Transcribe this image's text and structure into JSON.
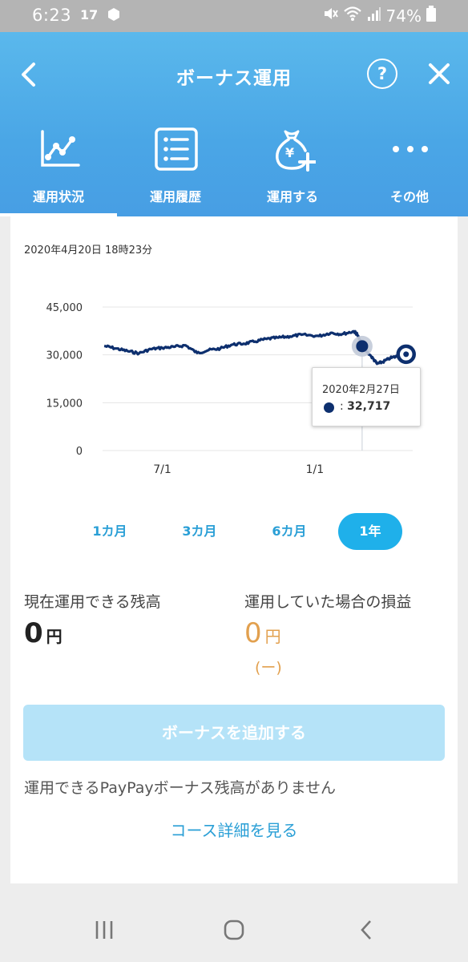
{
  "status_bar": {
    "time": "6:23",
    "notification": "17",
    "battery": "74%"
  },
  "header": {
    "title": "ボーナス運用",
    "help": "?"
  },
  "tabs": [
    {
      "label": "運用状況",
      "icon": "line-chart-icon",
      "active": true
    },
    {
      "label": "運用履歴",
      "icon": "list-icon",
      "active": false
    },
    {
      "label": "運用する",
      "icon": "money-bag-plus-icon",
      "active": false
    },
    {
      "label": "その他",
      "icon": "more-dots-icon",
      "active": false
    }
  ],
  "chart_section": {
    "timestamp": "2020年4月20日 18時23分",
    "tooltip": {
      "date": "2020年2月27日",
      "prefix": ":",
      "value": "32,717"
    }
  },
  "chart_data": {
    "type": "line",
    "yticks": [
      "45,000",
      "30,000",
      "15,000",
      "0"
    ],
    "ylim": [
      0,
      45000
    ],
    "xticks": [
      "7/1",
      "1/1"
    ],
    "grid": true,
    "series": [
      {
        "color": "#0d2f6e",
        "points": [
          [
            "2019-04-22",
            32800
          ],
          [
            "2019-05-06",
            32000
          ],
          [
            "2019-05-20",
            31200
          ],
          [
            "2019-06-03",
            30500
          ],
          [
            "2019-06-17",
            31800
          ],
          [
            "2019-07-01",
            32200
          ],
          [
            "2019-07-15",
            32500
          ],
          [
            "2019-07-29",
            33000
          ],
          [
            "2019-08-12",
            30600
          ],
          [
            "2019-08-26",
            31500
          ],
          [
            "2019-09-09",
            32000
          ],
          [
            "2019-09-23",
            33200
          ],
          [
            "2019-10-07",
            33500
          ],
          [
            "2019-10-21",
            34200
          ],
          [
            "2019-11-04",
            35000
          ],
          [
            "2019-11-18",
            35400
          ],
          [
            "2019-12-02",
            35800
          ],
          [
            "2019-12-16",
            36300
          ],
          [
            "2020-01-06",
            35900
          ],
          [
            "2020-01-20",
            36900
          ],
          [
            "2020-02-03",
            36500
          ],
          [
            "2020-02-17",
            37400
          ],
          [
            "2020-02-21",
            36500
          ],
          [
            "2020-02-27",
            32717
          ],
          [
            "2020-03-09",
            29500
          ],
          [
            "2020-03-16",
            27200
          ],
          [
            "2020-03-23",
            27800
          ],
          [
            "2020-04-01",
            29000
          ],
          [
            "2020-04-10",
            29600
          ],
          [
            "2020-04-20",
            30200
          ]
        ],
        "highlight_date": "2020-02-27",
        "highlight_value": 32717,
        "end_date": "2020-04-20",
        "end_value": 30200
      }
    ]
  },
  "periods": [
    {
      "label": "1カ月",
      "active": false
    },
    {
      "label": "3カ月",
      "active": false
    },
    {
      "label": "6カ月",
      "active": false
    },
    {
      "label": "1年",
      "active": true
    }
  ],
  "balance": {
    "label": "現在運用できる残高",
    "value": "0",
    "unit": "円"
  },
  "profit_loss": {
    "label": "運用していた場合の損益",
    "value": "0",
    "unit": "円",
    "sub": "(ー)"
  },
  "add_button": "ボーナスを追加する",
  "note": "運用できるPayPayボーナス残高がありません",
  "course_link": "コース詳細を見る",
  "colors": {
    "brand": "#479ee4",
    "accent": "#1fb0ea",
    "line": "#0d2f6e",
    "profit": "#e2a04e"
  }
}
